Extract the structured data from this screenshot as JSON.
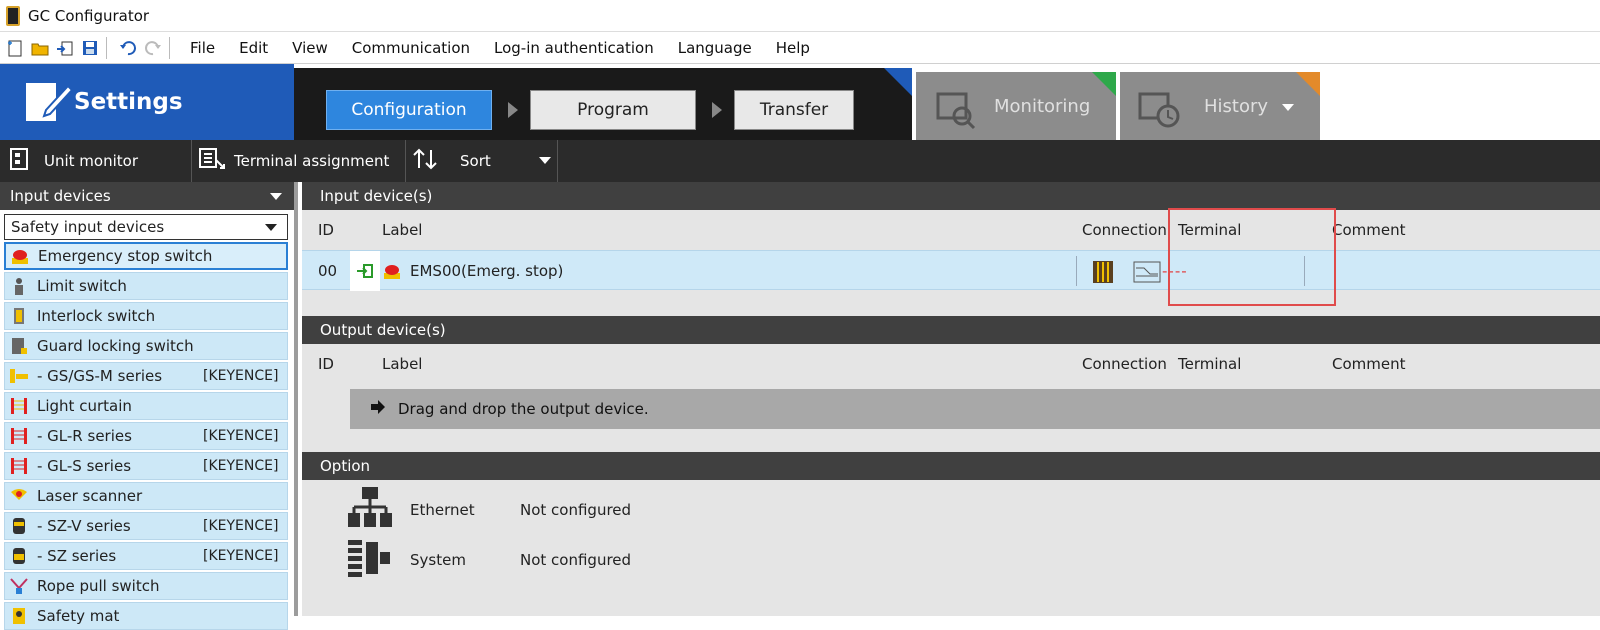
{
  "window": {
    "title": "GC Configurator"
  },
  "menu": [
    "File",
    "Edit",
    "View",
    "Communication",
    "Log-in authentication",
    "Language",
    "Help"
  ],
  "header": {
    "settings_label": "Settings",
    "steps": [
      "Configuration",
      "Program",
      "Transfer"
    ],
    "monitoring_label": "Monitoring",
    "history_label": "History"
  },
  "toolbar": {
    "unit_monitor": "Unit monitor",
    "terminal_assignment": "Terminal assignment",
    "sort": "Sort"
  },
  "sidebar": {
    "category": "Input devices",
    "filter": "Safety input devices",
    "items": [
      {
        "label": "Emergency stop switch",
        "maker": "",
        "icon": "emergency-stop-icon"
      },
      {
        "label": "Limit switch",
        "maker": "",
        "icon": "limit-switch-icon"
      },
      {
        "label": "Interlock switch",
        "maker": "",
        "icon": "interlock-switch-icon"
      },
      {
        "label": "Guard locking switch",
        "maker": "",
        "icon": "guard-locking-icon"
      },
      {
        "label": "- GS/GS-M series",
        "maker": "[KEYENCE]",
        "icon": "gs-series-icon"
      },
      {
        "label": "Light curtain",
        "maker": "",
        "icon": "light-curtain-icon"
      },
      {
        "label": "- GL-R series",
        "maker": "[KEYENCE]",
        "icon": "light-curtain-icon"
      },
      {
        "label": "- GL-S series",
        "maker": "[KEYENCE]",
        "icon": "light-curtain-icon"
      },
      {
        "label": "Laser scanner",
        "maker": "",
        "icon": "laser-scanner-icon"
      },
      {
        "label": "- SZ-V series",
        "maker": "[KEYENCE]",
        "icon": "scanner-icon"
      },
      {
        "label": "- SZ series",
        "maker": "[KEYENCE]",
        "icon": "scanner-icon"
      },
      {
        "label": "Rope pull switch",
        "maker": "",
        "icon": "rope-pull-icon"
      },
      {
        "label": "Safety mat",
        "maker": "",
        "icon": "safety-mat-icon"
      }
    ]
  },
  "input_section": {
    "title": "Input device(s)",
    "columns": {
      "id": "ID",
      "label": "Label",
      "connection": "Connection",
      "terminal": "Terminal",
      "comment": "Comment"
    },
    "rows": [
      {
        "id": "00",
        "label": "EMS00(Emerg. stop)",
        "terminal": "----",
        "comment": ""
      }
    ]
  },
  "output_section": {
    "title": "Output device(s)",
    "columns": {
      "id": "ID",
      "label": "Label",
      "connection": "Connection",
      "terminal": "Terminal",
      "comment": "Comment"
    },
    "drop_hint": "Drag and drop the output device."
  },
  "option_section": {
    "title": "Option",
    "items": [
      {
        "name": "Ethernet",
        "status": "Not configured",
        "icon": "network-icon"
      },
      {
        "name": "System",
        "status": "Not configured",
        "icon": "system-icon"
      }
    ]
  }
}
